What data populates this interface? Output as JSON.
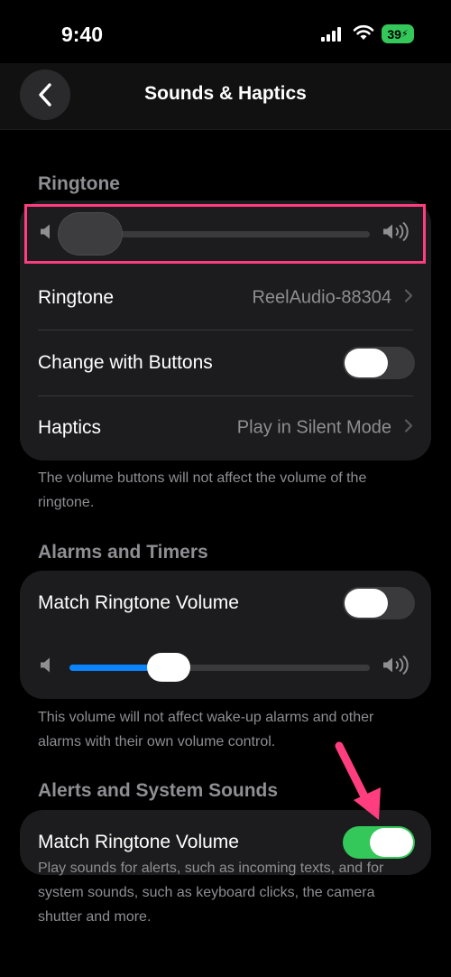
{
  "status_bar": {
    "time": "9:40",
    "battery_percent": "39"
  },
  "nav": {
    "title": "Sounds & Haptics"
  },
  "ringtone_section": {
    "header": "Ringtone",
    "slider_level": 0.0,
    "rows": {
      "ringtone": {
        "label": "Ringtone",
        "value": "ReelAudio-88304"
      },
      "change_with_buttons": {
        "label": "Change with Buttons",
        "on": false
      },
      "haptics": {
        "label": "Haptics",
        "value": "Play in Silent Mode"
      }
    },
    "footer": "The volume buttons will not affect the volume of the ringtone."
  },
  "alarms_section": {
    "header": "Alarms and Timers",
    "match_volume": {
      "label": "Match Ringtone Volume",
      "on": false
    },
    "slider_level": 0.27,
    "footer": "This volume will not affect wake-up alarms and other alarms with their own volume control."
  },
  "alerts_section": {
    "header": "Alerts and System Sounds",
    "match_volume": {
      "label": "Match Ringtone Volume",
      "on": true
    },
    "footer": "Play sounds for alerts, such as incoming texts, and for system sounds, such as keyboard clicks, the camera shutter and more."
  },
  "colors": {
    "accent_blue": "#0a84ff",
    "toggle_on": "#34c759",
    "highlight": "#ff3d7f",
    "card_bg": "#1c1c1e"
  }
}
